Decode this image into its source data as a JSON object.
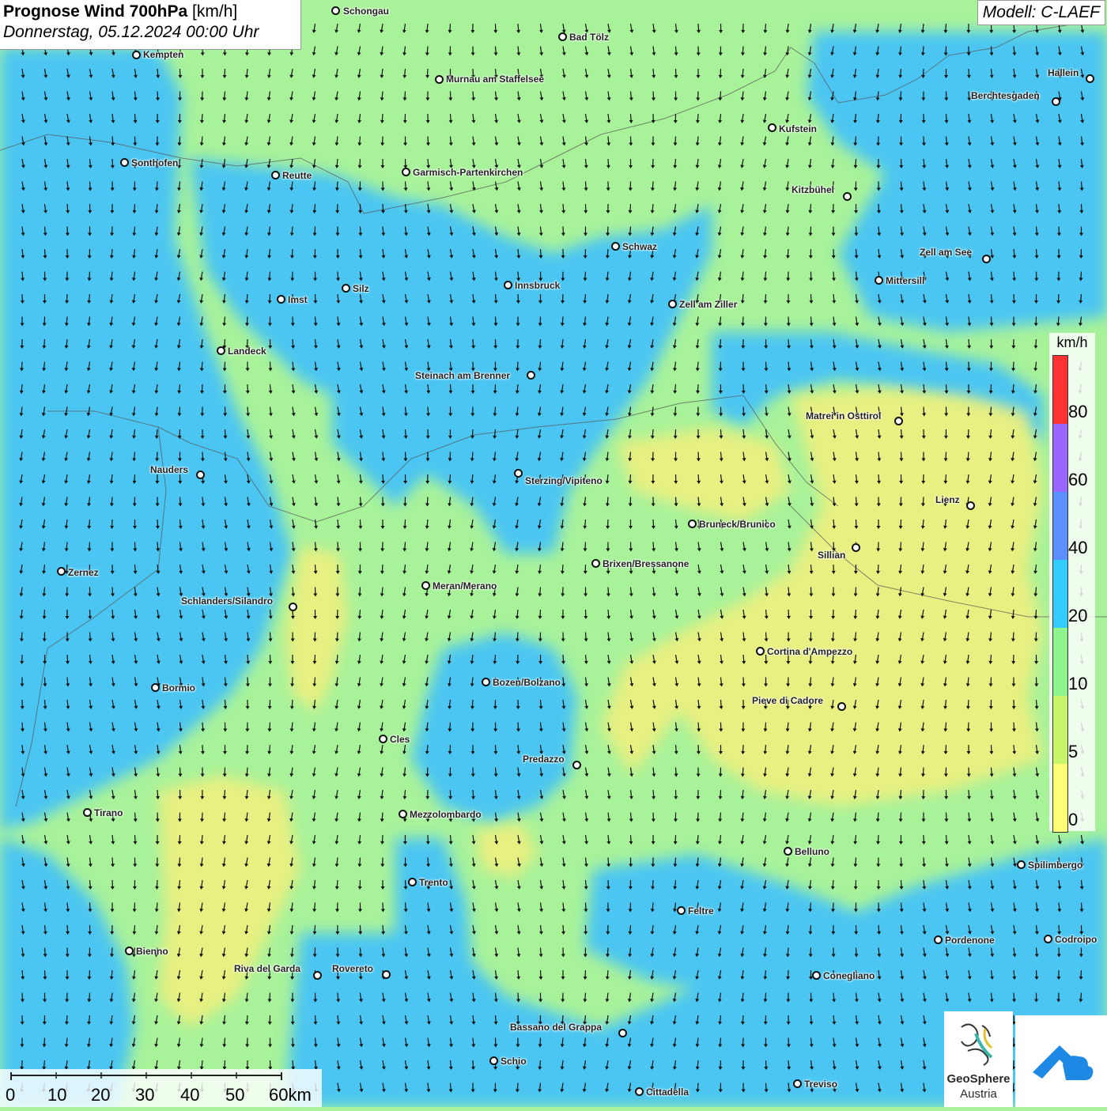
{
  "header": {
    "title_bold": "Prognose Wind 700hPa",
    "title_unit": "[km/h]",
    "datetime": "Donnerstag, 05.12.2024 00:00 Uhr"
  },
  "model": "Modell: C-LAEF",
  "legend": {
    "unit": "km/h",
    "ticks": [
      "80",
      "60",
      "40",
      "20",
      "10",
      "5",
      "0"
    ],
    "colors": [
      "#ff3333",
      "#9966ff",
      "#5c8fff",
      "#33ccff",
      "#8ef58e",
      "#c8f56a",
      "#ffff77"
    ]
  },
  "scalebar": {
    "labels": [
      "0",
      "10",
      "20",
      "30",
      "40",
      "50",
      "60km"
    ]
  },
  "logo": {
    "line1": "GeoSphere",
    "line2": "Austria"
  },
  "colors": {
    "calm_yellow": "#eef07e",
    "light_green": "#a8f29a",
    "blue": "#4cc6f2",
    "arrow": "#111111"
  },
  "cities": [
    {
      "name": "Schongau"
    },
    {
      "name": "Kempten"
    },
    {
      "name": "Bad Tölz"
    },
    {
      "name": "Murnau am Staffelsee"
    },
    {
      "name": "Hallein"
    },
    {
      "name": "Berchtesgaden"
    },
    {
      "name": "Kufstein"
    },
    {
      "name": "Sonthofen"
    },
    {
      "name": "Reutte"
    },
    {
      "name": "Garmisch-Partenkirchen"
    },
    {
      "name": "Kitzbühel"
    },
    {
      "name": "Schwaz"
    },
    {
      "name": "Zell am See"
    },
    {
      "name": "Innsbruck"
    },
    {
      "name": "Mittersill"
    },
    {
      "name": "Silz"
    },
    {
      "name": "Imst"
    },
    {
      "name": "Zell am Ziller"
    },
    {
      "name": "Landeck"
    },
    {
      "name": "Steinach am Brenner"
    },
    {
      "name": "Matrei in Osttirol"
    },
    {
      "name": "Nauders"
    },
    {
      "name": "Sterzing/Vipiteno"
    },
    {
      "name": "Lienz"
    },
    {
      "name": "Bruneck/Brunico"
    },
    {
      "name": "Sillian"
    },
    {
      "name": "Brixen/Bressanone"
    },
    {
      "name": "Zernez"
    },
    {
      "name": "Meran/Merano"
    },
    {
      "name": "Schlanders/Silandro"
    },
    {
      "name": "Cortina d'Ampezzo"
    },
    {
      "name": "Bozen/Bolzano"
    },
    {
      "name": "Bormio"
    },
    {
      "name": "Pieve di Cadore"
    },
    {
      "name": "Cles"
    },
    {
      "name": "Predazzo"
    },
    {
      "name": "Tirano"
    },
    {
      "name": "Mezzolombardo"
    },
    {
      "name": "Belluno"
    },
    {
      "name": "Spilimbergo"
    },
    {
      "name": "Trento"
    },
    {
      "name": "Feltre"
    },
    {
      "name": "Pordenone"
    },
    {
      "name": "Codroipo"
    },
    {
      "name": "Bienno"
    },
    {
      "name": "Riva del Garda"
    },
    {
      "name": "Rovereto"
    },
    {
      "name": "Conegliano"
    },
    {
      "name": "Bassano del Grappa"
    },
    {
      "name": "Schio"
    },
    {
      "name": "Treviso"
    },
    {
      "name": "Cittadella"
    }
  ]
}
